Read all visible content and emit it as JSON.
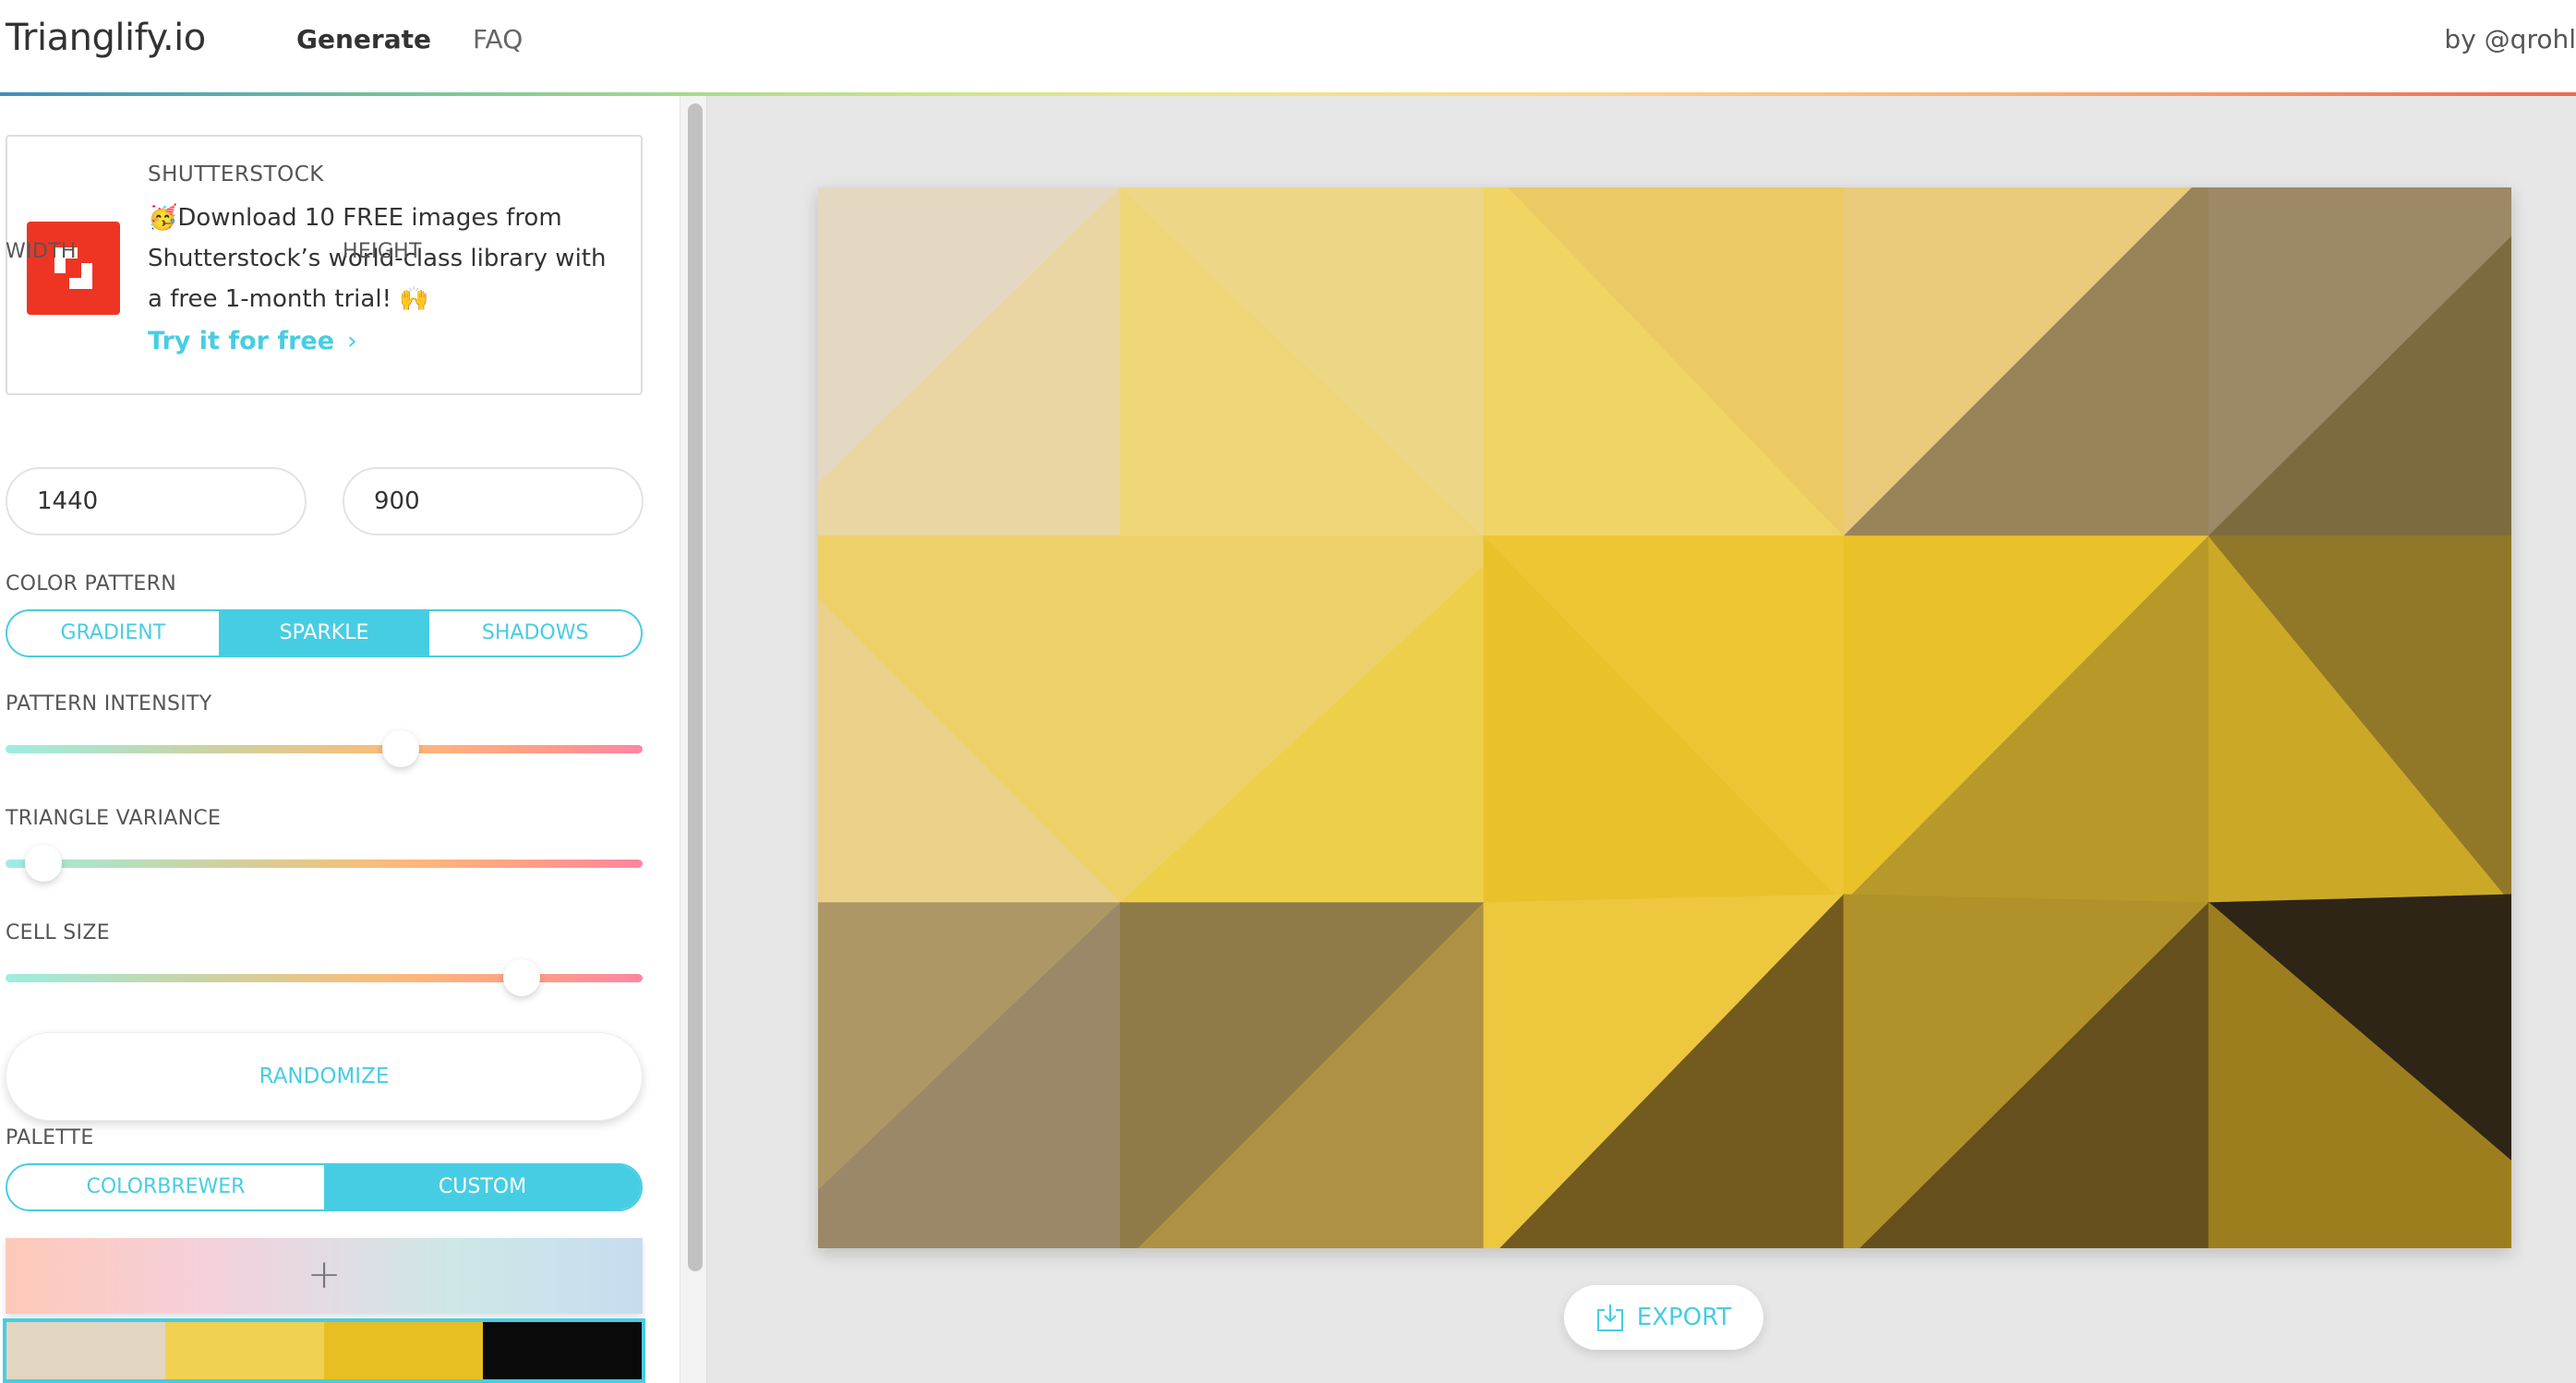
{
  "header": {
    "brand": "Trianglify.io",
    "nav": [
      {
        "label": "Generate",
        "active": true
      },
      {
        "label": "FAQ",
        "active": false
      }
    ],
    "byline": "by @qrohl",
    "accent_line_colors": [
      "#3d8fc0",
      "#74c29b",
      "#b6e08c",
      "#e8e88a",
      "#fbd98a",
      "#f9b078",
      "#ec6a4e"
    ]
  },
  "ad": {
    "sponsor": "SHUTTERSTOCK",
    "logo_icon": "shutterstock-logo-icon",
    "text": "🥳Download 10 FREE images from Shutterstock’s world-class library with a free 1-month trial! 🙌",
    "cta": "Try it for free",
    "cta_icon": "chevron-right-icon"
  },
  "settings": {
    "width": {
      "label": "WIDTH",
      "value": "1440"
    },
    "height": {
      "label": "HEIGHT",
      "value": "900"
    },
    "color_pattern": {
      "label": "COLOR PATTERN",
      "options": [
        "GRADIENT",
        "SPARKLE",
        "SHADOWS"
      ],
      "selected": "SPARKLE"
    },
    "pattern_intensity": {
      "label": "PATTERN INTENSITY",
      "value_fraction": 0.62
    },
    "triangle_variance": {
      "label": "TRIANGLE VARIANCE",
      "value_fraction": 0.06
    },
    "cell_size": {
      "label": "CELL SIZE",
      "value_fraction": 0.81
    },
    "randomize_label": "RANDOMIZE",
    "palette": {
      "label": "PALETTE",
      "options": [
        "COLORBREWER",
        "CUSTOM"
      ],
      "selected": "CUSTOM",
      "add_icon": "plus-icon",
      "custom_colors": [
        "#e2d6c1",
        "#f0d152",
        "#e8bf22",
        "#0b0a0a"
      ]
    }
  },
  "main": {
    "export_label": "EXPORT",
    "export_icon": "download-icon",
    "pattern_colors": {
      "r0c0a": "#e5d8c3",
      "r0c0b": "#ead6a3",
      "r0c1a": "#eed678",
      "r0c1b": "#edd686",
      "r0c2a": "#f0d564",
      "r0c2b": "#ebca63",
      "r0c3a": "#eacb7c",
      "r0c3b": "#99845a",
      "r0c4a": "#9d8868",
      "r0c4b": "#7d6b40",
      "r1c0a": "#eed069",
      "r1c0b": "#ebd18a",
      "r1c1a": "#eed06b",
      "r1c1b": "#eecf4a",
      "r1c2a": "#e9c22b",
      "r1c2b": "#edc634",
      "r1c3a": "#e9c22a",
      "r1c3b": "#b9982a",
      "r1c4a": "#cba927",
      "r1c4b": "#917829",
      "r2c0a": "#ad9865",
      "r2c0b": "#9b8869",
      "r2c1a": "#8f7b48",
      "r2c1b": "#ad9245",
      "r2c2a": "#edc83e",
      "r2c2b": "#735b1f",
      "r2c3a": "#b1912a",
      "r2c3b": "#654f1d",
      "r2c4a": "#2e2516",
      "r2c4b": "#9d7e1e"
    }
  }
}
